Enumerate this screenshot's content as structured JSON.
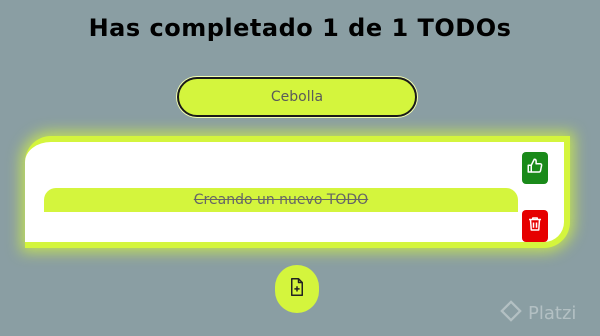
{
  "header": {
    "title": "Has completado 1 de 1 TODOs"
  },
  "search": {
    "value": "Cebolla"
  },
  "todos": [
    {
      "text": "Creando un nuevo TODO",
      "completed": true
    }
  ],
  "icons": {
    "complete": "thumbs-up-icon",
    "delete": "trash-icon",
    "add": "new-file-icon",
    "watermark": "platzi-logo"
  },
  "watermark": {
    "text": "Platzi"
  },
  "colors": {
    "background": "#8a9ea3",
    "accent": "#d4f53d",
    "complete": "#1a8a1a",
    "delete": "#e60000"
  }
}
